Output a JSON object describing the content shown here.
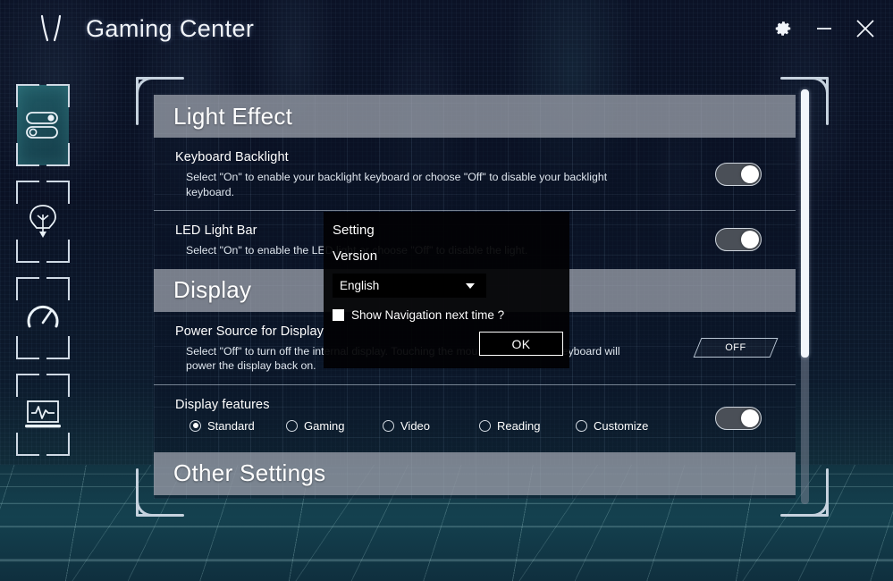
{
  "titlebar": {
    "logo_icon": "y-logo-icon",
    "title": "Gaming Center",
    "settings_icon": "gear-icon",
    "minimize_icon": "minimize-icon",
    "close_icon": "close-icon"
  },
  "sidebar": {
    "items": [
      {
        "icon": "toggles-icon",
        "name": "sidebar-item-settings",
        "active": true
      },
      {
        "icon": "bulb-icon",
        "name": "sidebar-item-lighting",
        "active": false
      },
      {
        "icon": "gauge-icon",
        "name": "sidebar-item-performance",
        "active": false
      },
      {
        "icon": "monitor-pulse-icon",
        "name": "sidebar-item-monitor",
        "active": false
      }
    ]
  },
  "sections": {
    "light_effect": {
      "title": "Light Effect",
      "rows": [
        {
          "label": "Keyboard Backlight",
          "desc": "Select \"On\" to enable your backlight keyboard or choose \"Off\" to disable your backlight keyboard.",
          "control": "toggle",
          "state": "on"
        },
        {
          "label": "LED Light Bar",
          "desc": "Select \"On\" to enable the LED light or choose \"Off\" to disable the light.",
          "control": "toggle",
          "state": "on"
        }
      ]
    },
    "display": {
      "title": "Display",
      "rows": [
        {
          "label": "Power Source for Display",
          "desc": "Select \"Off\" to turn off the internal display. Touching the mouse, touchpad or keyboard will power the display back on.",
          "control": "skew-button",
          "state": "OFF"
        },
        {
          "label": "Display features",
          "desc": "",
          "control": "toggle",
          "state": "on"
        }
      ],
      "display_features": {
        "options": [
          {
            "label": "Standard",
            "selected": true
          },
          {
            "label": "Gaming",
            "selected": false
          },
          {
            "label": "Video",
            "selected": false
          },
          {
            "label": "Reading",
            "selected": false
          },
          {
            "label": "Customize",
            "selected": false
          }
        ]
      }
    },
    "other_settings": {
      "title": "Other Settings"
    }
  },
  "overlay": {
    "title": "Setting",
    "subtitle": "Version",
    "language_value": "English",
    "caret_icon": "chevron-down-icon",
    "checkbox_label": "Show Navigation next time ?",
    "checkbox_checked": false,
    "ok_label": "OK"
  },
  "scrollbar": {
    "thumb_position_percent": 0,
    "thumb_size_percent": 65
  },
  "colors": {
    "accent_teal": "#2a6a76",
    "header_bar": "#a8acb6",
    "panel_border": "#c6d2de",
    "background_top": "#0b1226",
    "background_floor": "#14414f"
  }
}
